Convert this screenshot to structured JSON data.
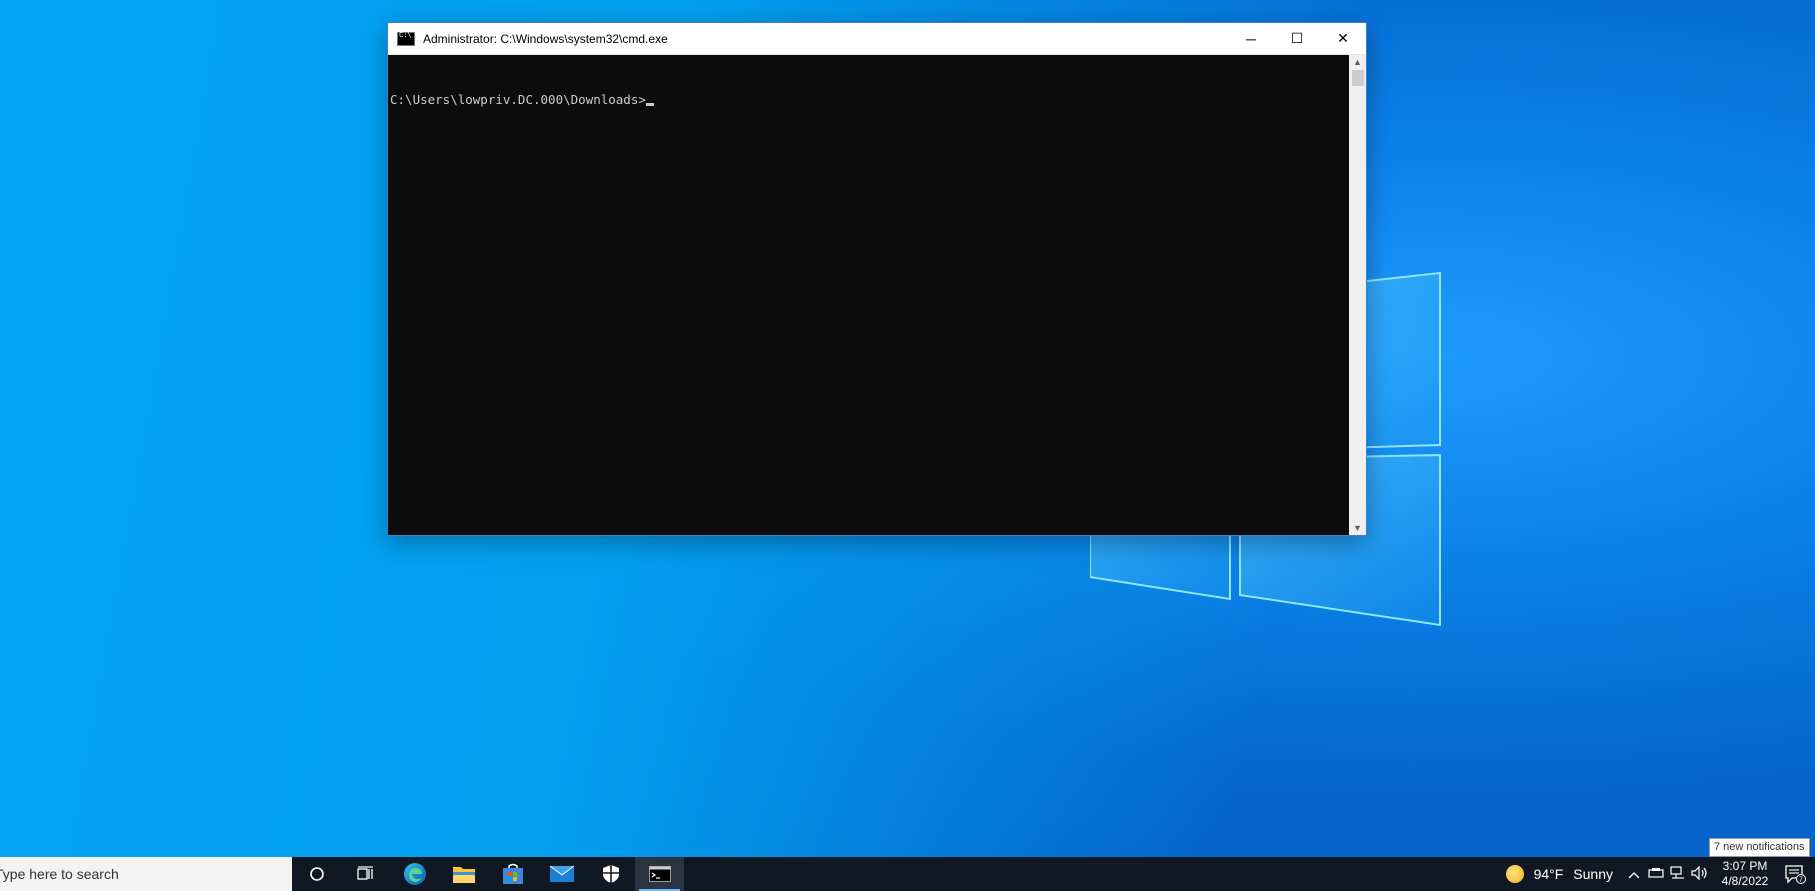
{
  "window": {
    "title": "Administrator: C:\\Windows\\system32\\cmd.exe",
    "minimize_glyph": "─",
    "maximize_glyph": "☐",
    "close_glyph": "✕",
    "prompt": "C:\\Users\\lowpriv.DC.000\\Downloads>"
  },
  "taskbar": {
    "search_placeholder": "Type here to search",
    "apps": [
      {
        "name": "cortana-icon"
      },
      {
        "name": "task-view-icon"
      },
      {
        "name": "edge-icon"
      },
      {
        "name": "file-explorer-icon"
      },
      {
        "name": "store-icon"
      },
      {
        "name": "mail-icon"
      },
      {
        "name": "security-icon"
      },
      {
        "name": "cmd-icon",
        "active": true
      }
    ],
    "weather": {
      "temperature": "94°F",
      "condition": "Sunny"
    },
    "clock": {
      "time": "3:07 PM",
      "date": "4/8/2022"
    }
  },
  "notifications": {
    "tooltip": "7 new notifications",
    "count": "7"
  },
  "colors": {
    "terminal_bg": "#0c0c0c",
    "terminal_fg": "#cccccc",
    "taskbar_bg": "#101923",
    "desktop_blue": "#0a7fe6"
  }
}
